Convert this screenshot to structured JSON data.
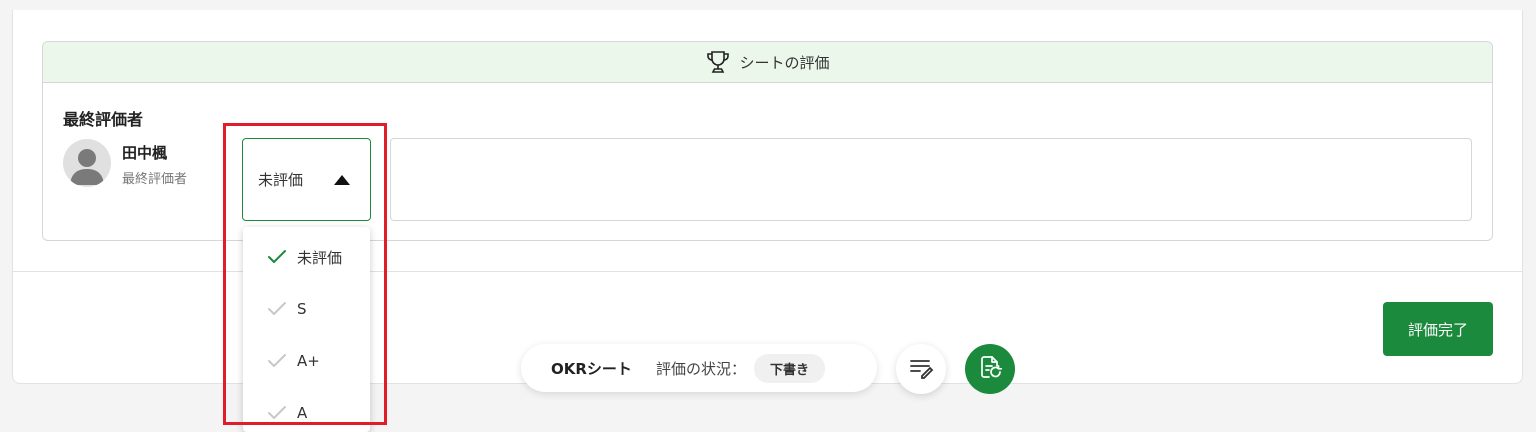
{
  "section": {
    "title": "シートの評価"
  },
  "evaluator": {
    "heading": "最終評価者",
    "name": "田中楓",
    "role": "最終評価者"
  },
  "grade_select": {
    "selected": "未評価",
    "options": [
      {
        "label": "未評価",
        "checked": true
      },
      {
        "label": "S",
        "checked": false
      },
      {
        "label": "A+",
        "checked": false
      },
      {
        "label": "A",
        "checked": false
      }
    ]
  },
  "actions": {
    "complete_label": "評価完了"
  },
  "status_bar": {
    "sheet_label": "OKRシート",
    "status_label": "評価の状況：",
    "status_value": "下書き"
  },
  "icons": {
    "section": "trophy-icon",
    "edit": "edit-lines-icon",
    "doc": "document-refresh-icon",
    "check": "check-icon"
  },
  "colors": {
    "accent": "#1c8a3d",
    "header_bg": "#eaf7ea",
    "highlight": "#e21d2b",
    "check_muted": "#c8c8c8"
  }
}
